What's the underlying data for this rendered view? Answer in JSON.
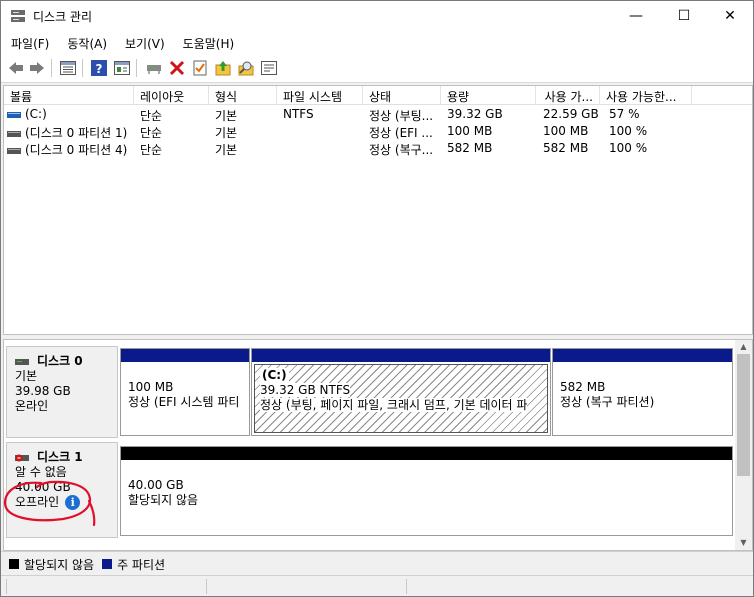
{
  "window": {
    "title": "디스크 관리",
    "controls": {
      "minimize": "—",
      "maximize": "☐",
      "close": "✕"
    }
  },
  "menu": [
    "파일(F)",
    "동작(A)",
    "보기(V)",
    "도움말(H)"
  ],
  "toolbar_icons": [
    "back-icon",
    "forward-icon",
    "list-view-icon",
    "help-icon",
    "properties-icon",
    "connect-icon",
    "delete-icon",
    "check-icon",
    "import-icon",
    "search-icon",
    "console-icon"
  ],
  "volume_list": {
    "columns": [
      "볼륨",
      "레이아웃",
      "형식",
      "파일 시스템",
      "상태",
      "용량",
      "사용 가...",
      "사용 가능한..."
    ],
    "rows": [
      {
        "volume": "(C:)",
        "layout": "단순",
        "type": "기본",
        "fs": "NTFS",
        "status": "정상 (부팅...",
        "capacity": "39.32 GB",
        "free": "22.59 GB",
        "pct": "57 %"
      },
      {
        "volume": "(디스크 0 파티션 1)",
        "layout": "단순",
        "type": "기본",
        "fs": "",
        "status": "정상 (EFI ...",
        "capacity": "100 MB",
        "free": "100 MB",
        "pct": "100 %"
      },
      {
        "volume": "(디스크 0 파티션 4)",
        "layout": "단순",
        "type": "기본",
        "fs": "",
        "status": "정상 (복구...",
        "capacity": "582 MB",
        "free": "582 MB",
        "pct": "100 %"
      }
    ]
  },
  "disks": [
    {
      "name": "디스크 0",
      "type": "기본",
      "size": "39.98 GB",
      "state": "온라인",
      "partitions": [
        {
          "title": "",
          "size": "100 MB",
          "status": "정상 (EFI 시스템 파티",
          "bar_color": "#0a1a8a"
        },
        {
          "title": "(C:)",
          "size": "39.32 GB NTFS",
          "status": "정상 (부팅, 페이지 파일, 크래시 덤프, 기본 데이터 파",
          "bar_color": "#0a1a8a"
        },
        {
          "title": "",
          "size": "582 MB",
          "status": "정상 (복구 파티션)",
          "bar_color": "#0a1a8a"
        }
      ]
    },
    {
      "name": "디스크 1",
      "type": "알 수 없음",
      "size": "40.00 GB",
      "state": "오프라인",
      "info_glyph": "i",
      "partitions": [
        {
          "size": "40.00 GB",
          "status": "할당되지 않음",
          "bar_color": "#000000"
        }
      ]
    }
  ],
  "legend": [
    {
      "label": "할당되지 않음",
      "color": "#000000"
    },
    {
      "label": "주 파티션",
      "color": "#0a1a8a"
    }
  ],
  "annotation_color": "#e0102a"
}
